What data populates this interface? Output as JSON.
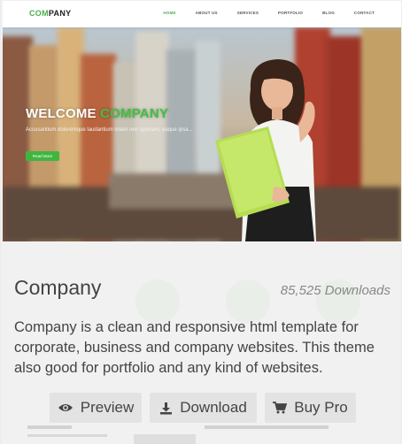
{
  "preview": {
    "logo_part1": "COM",
    "logo_part2": "PANY",
    "nav": [
      "HOME",
      "ABOUT US",
      "SERVICES",
      "PORTFOLIO",
      "BLOG",
      "CONTACT"
    ],
    "hero_title_part1": "WELCOME",
    "hero_title_part2": "COMPANY",
    "hero_subtitle": "Accusantium doloremque laudantium totam rem aperiam, eaque ipsa...",
    "hero_button": "Read More"
  },
  "theme": {
    "name": "Company",
    "downloads": "85,525 Downloads",
    "description": "Company is a clean and responsive html template for corporate, business and company websites. This theme also good for portfolio and any kind of websites."
  },
  "actions": {
    "preview_label": "Preview",
    "download_label": "Download",
    "buy_label": "Buy Pro"
  },
  "icons": {
    "preview": "eye-icon",
    "download": "download-icon",
    "buy": "cart-icon"
  },
  "colors": {
    "accent": "#3fb63f",
    "button_bg": "#e3e3e3",
    "text": "#444444"
  }
}
